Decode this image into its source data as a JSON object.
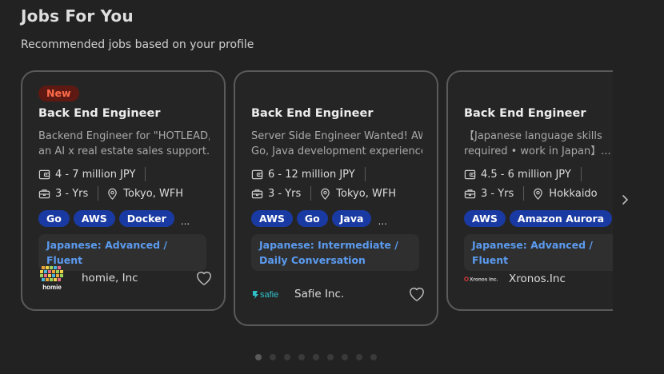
{
  "header": {
    "title": "Jobs For You",
    "subtitle": "Recommended jobs based on your profile"
  },
  "cards": [
    {
      "badge": "New",
      "title": "Back End Engineer",
      "desc_line1": "Backend Engineer for \"HOTLEAD,\"",
      "desc_line2": "an AI x real estate sales support...",
      "salary": "4 - 7 million JPY",
      "experience": "3 - Yrs",
      "location": "Tokyo, WFH",
      "tags": [
        "Go",
        "AWS",
        "Docker"
      ],
      "more": "...",
      "language": "Japanese: Advanced / Fluent",
      "company": "homie, Inc",
      "logo_text": "homie"
    },
    {
      "title": "Back End Engineer",
      "desc_line1": "Server Side Engineer Wanted! AWS,",
      "desc_line2": "Go, Java development experience...",
      "salary": "6 - 12 million JPY",
      "experience": "3 - Yrs",
      "location": "Tokyo, WFH",
      "tags": [
        "AWS",
        "Go",
        "Java"
      ],
      "more": "...",
      "language": "Japanese: Intermediate / Daily Conversation",
      "company": "Safie Inc.",
      "logo_text": "safie"
    },
    {
      "title": "Back End Engineer",
      "desc_line1": "【Japanese language skills",
      "desc_line2": "required • work in Japan】...",
      "salary": "4.5 - 6 million JPY",
      "experience": "3 - Yrs",
      "location": "Hokkaido",
      "tags": [
        "AWS",
        "Amazon Aurora"
      ],
      "more": "...",
      "language": "Japanese: Advanced / Fluent",
      "company": "Xronos.Inc",
      "logo_text": "Xronos Inc."
    }
  ],
  "icons": {
    "salary": "wallet-icon",
    "experience": "briefcase-icon",
    "location": "location-pin-icon",
    "favorite": "heart-icon",
    "next": "chevron-right-icon"
  },
  "colors": {
    "background": "#222222",
    "tag": "#1a3aa3",
    "language_text": "#5b9bf0",
    "new_badge_bg": "#5e1a12",
    "new_badge_text": "#ff6b4a"
  },
  "pagination": {
    "total_dots": 9,
    "active_index": 0
  }
}
